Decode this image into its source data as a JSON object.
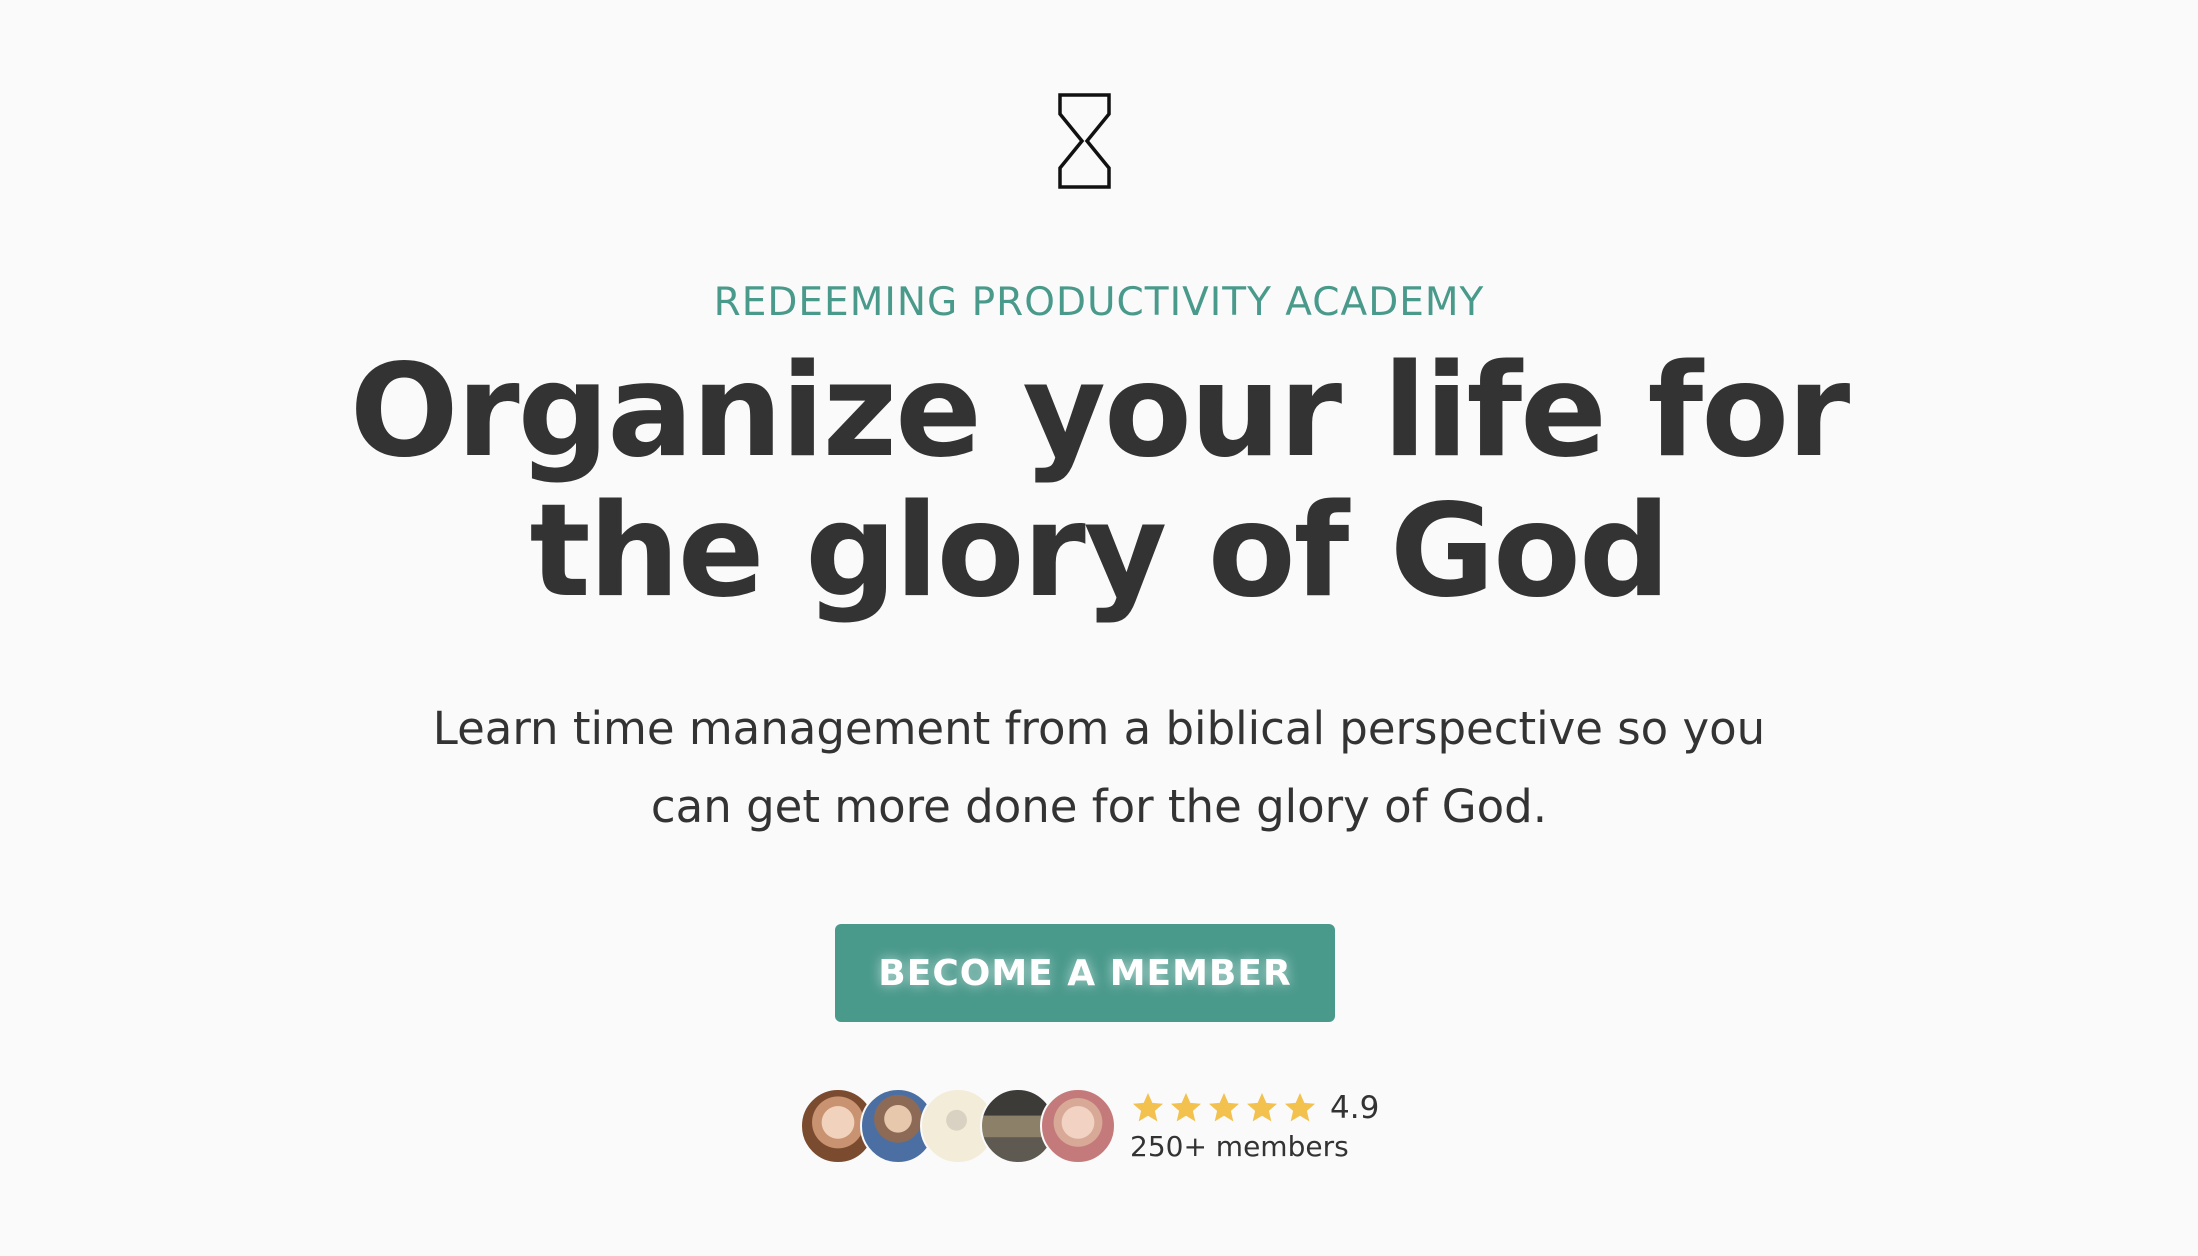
{
  "brand": {
    "logo_icon": "hourglass-icon",
    "accent_color": "#4a9a8c"
  },
  "hero": {
    "eyebrow": "REDEEMING PRODUCTIVITY ACADEMY",
    "headline_line1": "Organize your life for",
    "headline_line2": "the glory of God",
    "subtext_line1": "Learn time management from a biblical perspective so you",
    "subtext_line2": "can get more done for the glory of God.",
    "cta_label": "BECOME A MEMBER"
  },
  "social_proof": {
    "avatars": [
      "member-avatar",
      "member-avatar",
      "member-avatar",
      "member-avatar",
      "member-avatar"
    ],
    "star_icon": "star-icon",
    "star_color": "#f2c14e",
    "stars": 5,
    "rating": "4.9",
    "members": "250+ members"
  }
}
